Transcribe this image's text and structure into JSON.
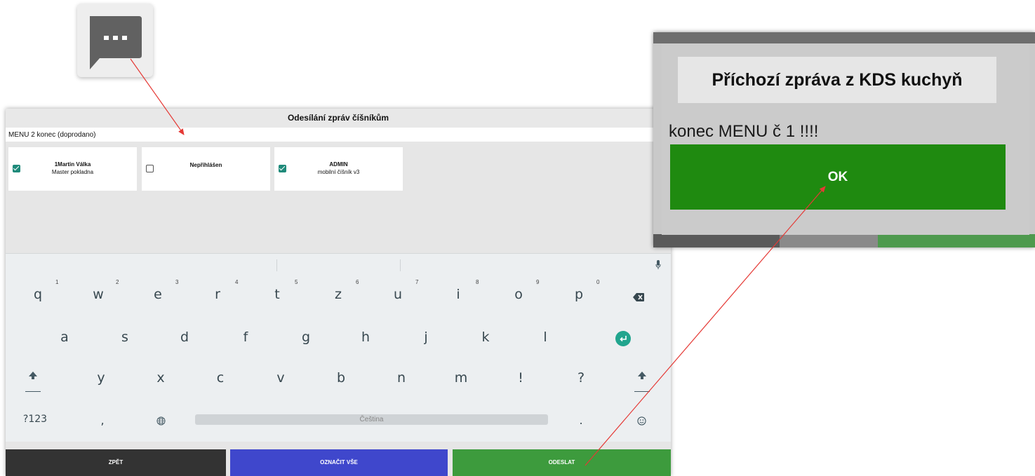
{
  "chat_icon": {
    "name": "chat-bubble-icon"
  },
  "panel": {
    "title": "Odesílání zpráv číšníkům",
    "message_value": "MENU 2 konec (doprodano)",
    "waiters": [
      {
        "name": "1Martin Válka",
        "role": "Master pokladna",
        "checked": true
      },
      {
        "name": "Nepřihlášen",
        "role": "",
        "checked": false
      },
      {
        "name": "ADMIN",
        "role": "mobilní číšník v3",
        "checked": true
      }
    ]
  },
  "keyboard": {
    "row1": [
      "q",
      "w",
      "e",
      "r",
      "t",
      "z",
      "u",
      "i",
      "o",
      "p"
    ],
    "row1_nums": [
      "1",
      "2",
      "3",
      "4",
      "5",
      "6",
      "7",
      "8",
      "9",
      "0"
    ],
    "row2": [
      "a",
      "s",
      "d",
      "f",
      "g",
      "h",
      "j",
      "k",
      "l"
    ],
    "row3": [
      "y",
      "x",
      "c",
      "v",
      "b",
      "n",
      "m",
      "!",
      "?"
    ],
    "symbols_key": "?123",
    "comma_key": ",",
    "space_label": "Čeština",
    "period_key": ".",
    "icons": {
      "mic": "mic-icon",
      "backspace": "backspace-icon",
      "enter": "enter-icon",
      "shift": "shift-icon",
      "globe": "globe-icon",
      "emoji": "emoji-icon"
    }
  },
  "buttons": {
    "back": "ZPĚT",
    "mark_all": "OZNAČIT VŠE",
    "send": "ODESLAT"
  },
  "dialog": {
    "title": "Příchozí zpráva z KDS kuchyň",
    "message": "konec MENU č 1 !!!!",
    "ok_label": "OK"
  },
  "colors": {
    "send_green": "#3d9b3d",
    "mark_blue": "#3f47cc",
    "back_dark": "#333333",
    "ok_green": "#1f8a10",
    "checkbox_teal": "#1f8a7a",
    "arrow_red": "#e53935"
  }
}
